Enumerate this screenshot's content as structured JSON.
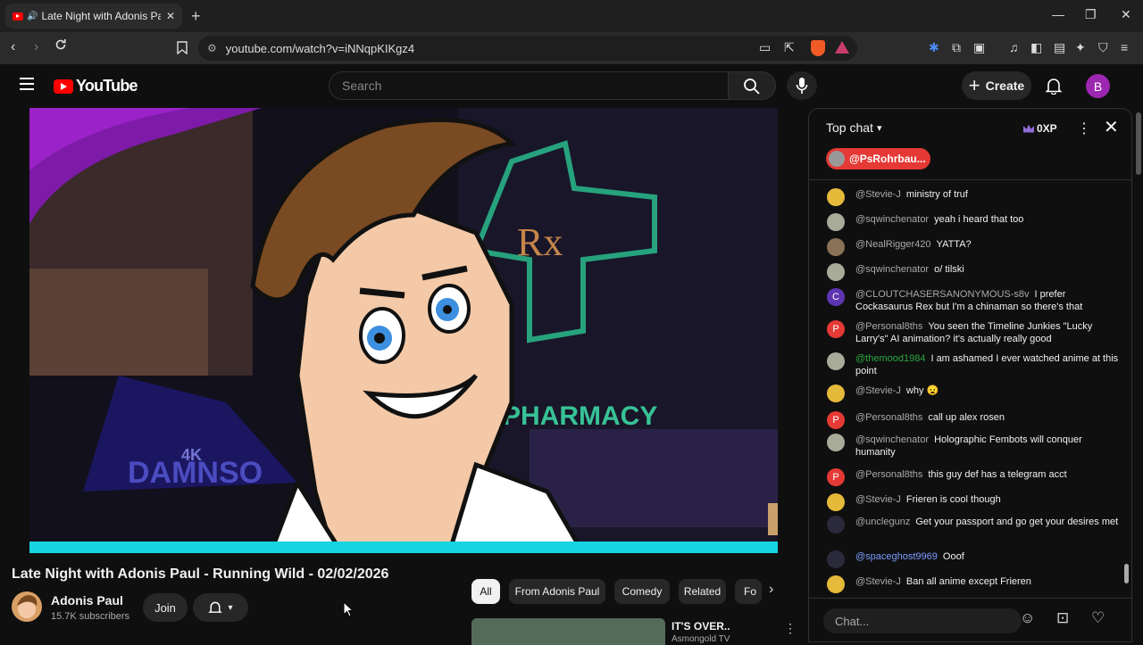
{
  "browser": {
    "tab_title": "Late Night with Adonis Paul -",
    "url": "youtube.com/watch?v=iNNqpKIKgz4",
    "window_controls": {
      "minimize": "—",
      "restore": "❐",
      "close": "✕"
    }
  },
  "youtube": {
    "logo_text": "YouTube",
    "search_placeholder": "Search",
    "create_label": "Create",
    "avatar_letter": "B"
  },
  "video": {
    "title": "Late Night with Adonis Paul - Running Wild - 02/02/2026",
    "frame_text": {
      "sign": "PHARMACY",
      "bg_text": "DAMNSO",
      "bg_badge": "4K",
      "rx": "Rx"
    },
    "channel": {
      "name": "Adonis Paul",
      "subscribers": "15.7K subscribers"
    },
    "join_label": "Join"
  },
  "chips": [
    {
      "label": "All",
      "active": true
    },
    {
      "label": "From Adonis Paul",
      "active": false
    },
    {
      "label": "Comedy",
      "active": false
    },
    {
      "label": "Related",
      "active": false
    },
    {
      "label": "Fo",
      "active": false
    }
  ],
  "recommendation": {
    "title": "IT'S OVER..",
    "channel": "Asmongold TV"
  },
  "chat": {
    "mode_label": "Top chat",
    "xp_label": "0XP",
    "pinned_user": "@PsRohrbau...",
    "input_placeholder": "Chat...",
    "messages": [
      {
        "author": "@Stevie-J",
        "text": "ministry of truf",
        "avatar_color": "yellow",
        "avatar_letter": ""
      },
      {
        "author": "@sqwinchenator",
        "text": "yeah i heard that too",
        "avatar_color": "grey",
        "avatar_letter": ""
      },
      {
        "author": "@NealRigger420",
        "text": "YATTA?",
        "avatar_color": "brown",
        "avatar_letter": ""
      },
      {
        "author": "@sqwinchenator",
        "text": "o/ tilski",
        "avatar_color": "grey",
        "avatar_letter": ""
      },
      {
        "author": "@CLOUTCHASERSANONYMOUS-s8v",
        "text": "I prefer Cockasaurus Rex but I'm a chinaman so there's that",
        "avatar_color": "purple",
        "avatar_letter": "C"
      },
      {
        "author": "@Personal8ths",
        "text": "You seen the Timeline Junkies \"Lucky Larry's\" AI animation? it's actually really good",
        "avatar_color": "red",
        "avatar_letter": "P"
      },
      {
        "author": "@themood1984",
        "text": "I am ashamed I ever watched anime at this point",
        "avatar_color": "grey",
        "avatar_letter": "",
        "author_style": "green"
      },
      {
        "author": "@Stevie-J",
        "text": "why 😦",
        "avatar_color": "yellow",
        "avatar_letter": ""
      },
      {
        "author": "@Personal8ths",
        "text": "call up alex rosen",
        "avatar_color": "red",
        "avatar_letter": "P"
      },
      {
        "author": "@sqwinchenator",
        "text": "Holographic Fembots will conquer humanity",
        "avatar_color": "grey",
        "avatar_letter": ""
      },
      {
        "author": "@Personal8ths",
        "text": "this guy def has a telegram acct",
        "avatar_color": "red",
        "avatar_letter": "P"
      },
      {
        "author": "@Stevie-J",
        "text": "Frieren is cool though",
        "avatar_color": "yellow",
        "avatar_letter": ""
      },
      {
        "author": "@unclegunz",
        "text": "Get your passport and go get your desires met",
        "avatar_color": "dark",
        "avatar_letter": ""
      },
      {
        "author": "@spaceghost9969",
        "text": "Ooof",
        "avatar_color": "dark",
        "avatar_letter": "",
        "author_style": "blue"
      },
      {
        "author": "@Stevie-J",
        "text": "Ban all anime except Frieren",
        "avatar_color": "yellow",
        "avatar_letter": ""
      }
    ]
  },
  "colors": {
    "brand_red": "#ff0000",
    "pinned_red": "#e53935",
    "bg": "#0f0f0f"
  }
}
